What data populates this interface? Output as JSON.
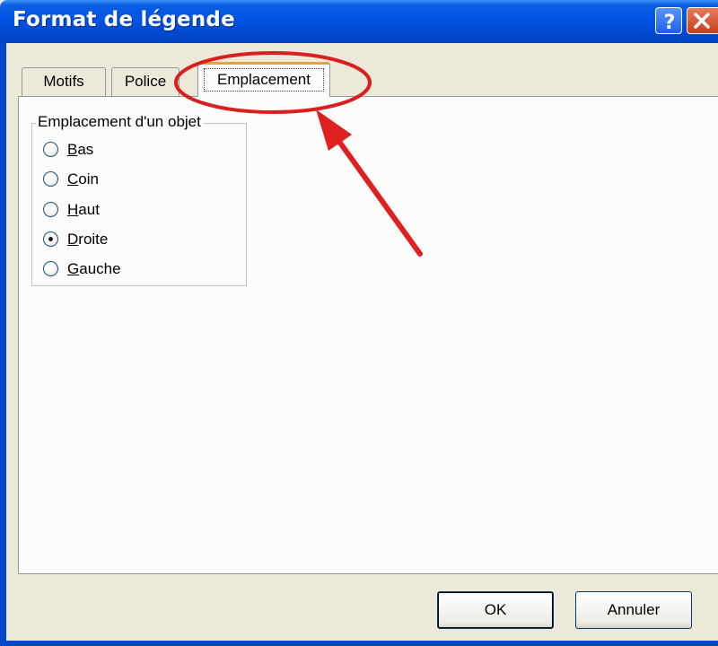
{
  "window": {
    "title": "Format de légende"
  },
  "tabs": [
    {
      "label": "Motifs"
    },
    {
      "label": "Police"
    },
    {
      "label": "Emplacement",
      "selected": true
    }
  ],
  "group": {
    "label": "Emplacement d'un objet",
    "options": [
      {
        "first": "B",
        "rest": "as",
        "selected": false
      },
      {
        "first": "C",
        "rest": "oin",
        "selected": false
      },
      {
        "first": "H",
        "rest": "aut",
        "selected": false
      },
      {
        "first": "D",
        "rest": "roite",
        "selected": true
      },
      {
        "first": "G",
        "rest": "auche",
        "selected": false
      }
    ]
  },
  "buttons": {
    "ok": "OK",
    "cancel": "Annuler"
  },
  "icons": {
    "help": "help-icon",
    "close": "close-icon"
  },
  "colors": {
    "titlebar": "#0055e5",
    "annotation": "#e02020",
    "selected_tab_accent": "#e6a33c"
  }
}
